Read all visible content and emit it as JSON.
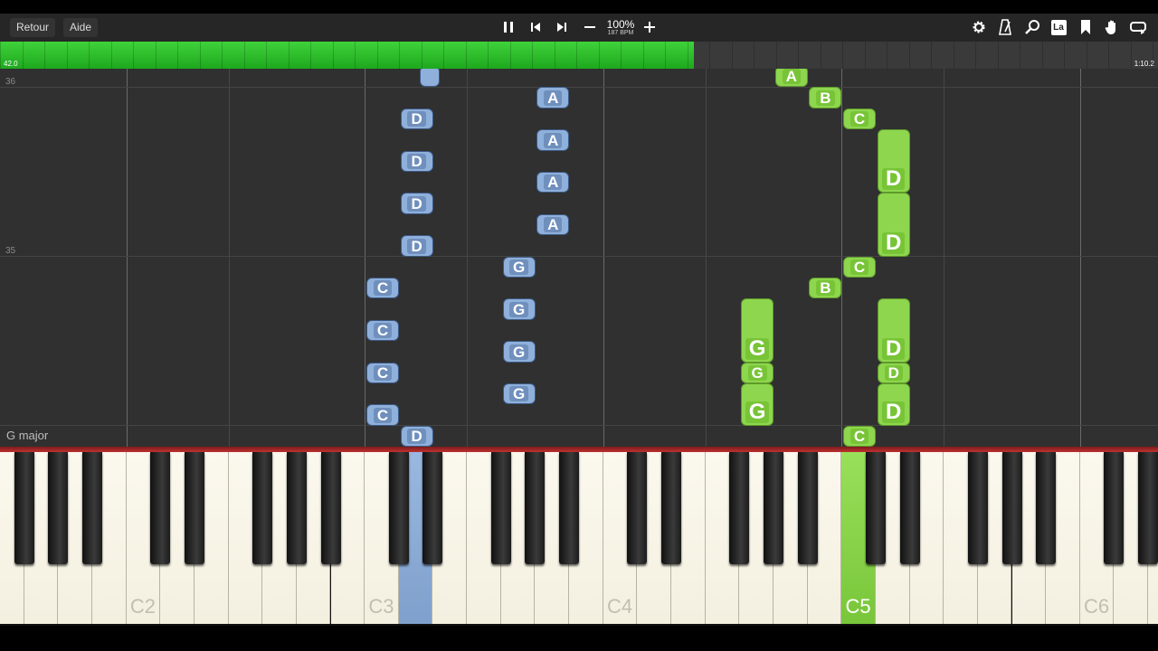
{
  "toolbar": {
    "back_label": "Retour",
    "help_label": "Aide",
    "zoom": "100%",
    "bpm": "187 BPM",
    "icons": [
      "pause-icon",
      "skip-back-icon",
      "skip-forward-icon",
      "minus-icon",
      "plus-icon",
      "gear-icon",
      "metronome-icon",
      "search-icon",
      "note-label-icon",
      "bookmark-icon",
      "hand-icon",
      "loop-icon"
    ],
    "note_label_text": "La"
  },
  "progress": {
    "start_label": "42.0",
    "end_label": "1:10.2",
    "fraction": 0.599,
    "color": "#2ab82a"
  },
  "roll": {
    "measures": [
      "36",
      "35"
    ],
    "key_signature": "G major",
    "note_colors": {
      "left": "#8fb0da",
      "right": "#8ed64e"
    }
  },
  "notes": [
    {
      "name": "",
      "hand": "left",
      "key": 13,
      "col": 0,
      "row": 0,
      "len": 1
    },
    {
      "name": "D",
      "hand": "left",
      "key": 12,
      "row": 2,
      "len": 1
    },
    {
      "name": "D",
      "hand": "left",
      "key": 12,
      "row": 4,
      "len": 1
    },
    {
      "name": "D",
      "hand": "left",
      "key": 12,
      "row": 6,
      "len": 1
    },
    {
      "name": "D",
      "hand": "left",
      "key": 12,
      "row": 8,
      "len": 1
    },
    {
      "name": "A",
      "hand": "left",
      "key": 16,
      "row": 1,
      "len": 1
    },
    {
      "name": "A",
      "hand": "left",
      "key": 16,
      "row": 3,
      "len": 1
    },
    {
      "name": "A",
      "hand": "left",
      "key": 16,
      "row": 5,
      "len": 1
    },
    {
      "name": "A",
      "hand": "left",
      "key": 16,
      "row": 7,
      "len": 1
    },
    {
      "name": "G",
      "hand": "left",
      "key": 15,
      "row": 9,
      "len": 1
    },
    {
      "name": "G",
      "hand": "left",
      "key": 15,
      "row": 11,
      "len": 1
    },
    {
      "name": "G",
      "hand": "left",
      "key": 15,
      "row": 13,
      "len": 1
    },
    {
      "name": "G",
      "hand": "left",
      "key": 15,
      "row": 15,
      "len": 1
    },
    {
      "name": "C",
      "hand": "left",
      "key": 11,
      "row": 10,
      "len": 1
    },
    {
      "name": "C",
      "hand": "left",
      "key": 11,
      "row": 12,
      "len": 1
    },
    {
      "name": "C",
      "hand": "left",
      "key": 11,
      "row": 14,
      "len": 1
    },
    {
      "name": "C",
      "hand": "left",
      "key": 11,
      "row": 16,
      "len": 1
    },
    {
      "name": "D",
      "hand": "left",
      "key": 12,
      "row": 17,
      "len": 1
    },
    {
      "name": "A",
      "hand": "right",
      "key": 23,
      "row": 0,
      "len": 1
    },
    {
      "name": "B",
      "hand": "right",
      "key": 24,
      "row": 1,
      "len": 1
    },
    {
      "name": "C",
      "hand": "right",
      "key": 25,
      "row": 2,
      "len": 1
    },
    {
      "name": "D",
      "hand": "right",
      "key": 26,
      "row": 3,
      "len": 3
    },
    {
      "name": "D",
      "hand": "right",
      "key": 26,
      "row": 6,
      "len": 3
    },
    {
      "name": "C",
      "hand": "right",
      "key": 25,
      "row": 9,
      "len": 1
    },
    {
      "name": "B",
      "hand": "right",
      "key": 24,
      "row": 10,
      "len": 1
    },
    {
      "name": "G",
      "hand": "right",
      "key": 22,
      "row": 11,
      "len": 3
    },
    {
      "name": "G",
      "hand": "right",
      "key": 22,
      "row": 14,
      "len": 1
    },
    {
      "name": "G",
      "hand": "right",
      "key": 22,
      "row": 15,
      "len": 2
    },
    {
      "name": "D",
      "hand": "right",
      "key": 26,
      "row": 11,
      "len": 3
    },
    {
      "name": "D",
      "hand": "right",
      "key": 26,
      "row": 14,
      "len": 1
    },
    {
      "name": "D",
      "hand": "right",
      "key": 26,
      "row": 15,
      "len": 2
    },
    {
      "name": "C",
      "hand": "right",
      "key": 25,
      "row": 17,
      "len": 1
    }
  ],
  "keyboard": {
    "octave_labels": [
      {
        "key": 4,
        "label": "C2"
      },
      {
        "key": 11,
        "label": "C3"
      },
      {
        "key": 18,
        "label": "C4"
      },
      {
        "key": 25,
        "label": "C5"
      },
      {
        "key": 32,
        "label": "C6"
      }
    ],
    "pressed": [
      {
        "key": 12,
        "hand": "left"
      },
      {
        "key": 25,
        "hand": "right"
      }
    ]
  }
}
